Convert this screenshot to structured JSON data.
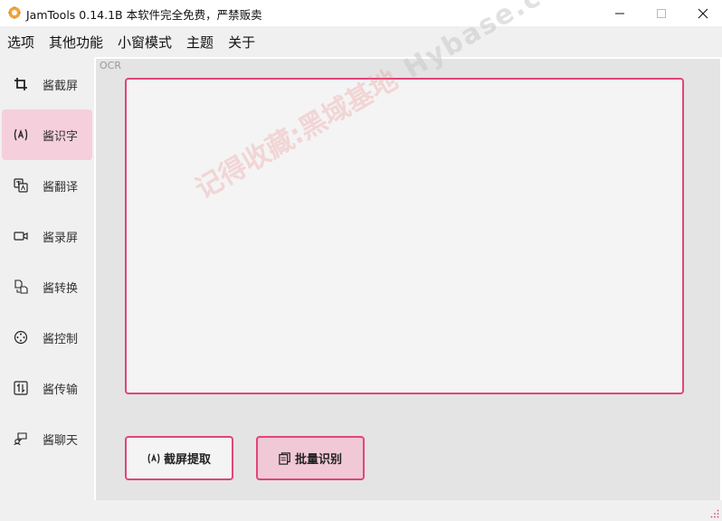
{
  "window": {
    "title": "JamTools 0.14.1B 本软件完全免费，严禁贩卖"
  },
  "menu": {
    "items": [
      "选项",
      "其他功能",
      "小窗模式",
      "主题",
      "关于"
    ]
  },
  "sidebar": {
    "items": [
      {
        "label": "酱截屏",
        "icon": "crop-icon",
        "active": false
      },
      {
        "label": "酱识字",
        "icon": "text-recognition-icon",
        "active": true
      },
      {
        "label": "酱翻译",
        "icon": "translate-icon",
        "active": false
      },
      {
        "label": "酱录屏",
        "icon": "video-camera-icon",
        "active": false
      },
      {
        "label": "酱转换",
        "icon": "file-convert-icon",
        "active": false
      },
      {
        "label": "酱控制",
        "icon": "remote-control-icon",
        "active": false
      },
      {
        "label": "酱传输",
        "icon": "transfer-icon",
        "active": false
      },
      {
        "label": "酱聊天",
        "icon": "chat-icon",
        "active": false
      }
    ]
  },
  "main": {
    "section_label": "OCR",
    "text_area_value": "",
    "capture_button": "截屏提取",
    "batch_button": "批量识别"
  },
  "watermark": {
    "chinese": "记得收藏:黑域基地",
    "english": "Hybase.com"
  },
  "colors": {
    "accent": "#e2447a",
    "active_item": "#f5cfdc",
    "panel_bg": "#e4e4e4"
  }
}
